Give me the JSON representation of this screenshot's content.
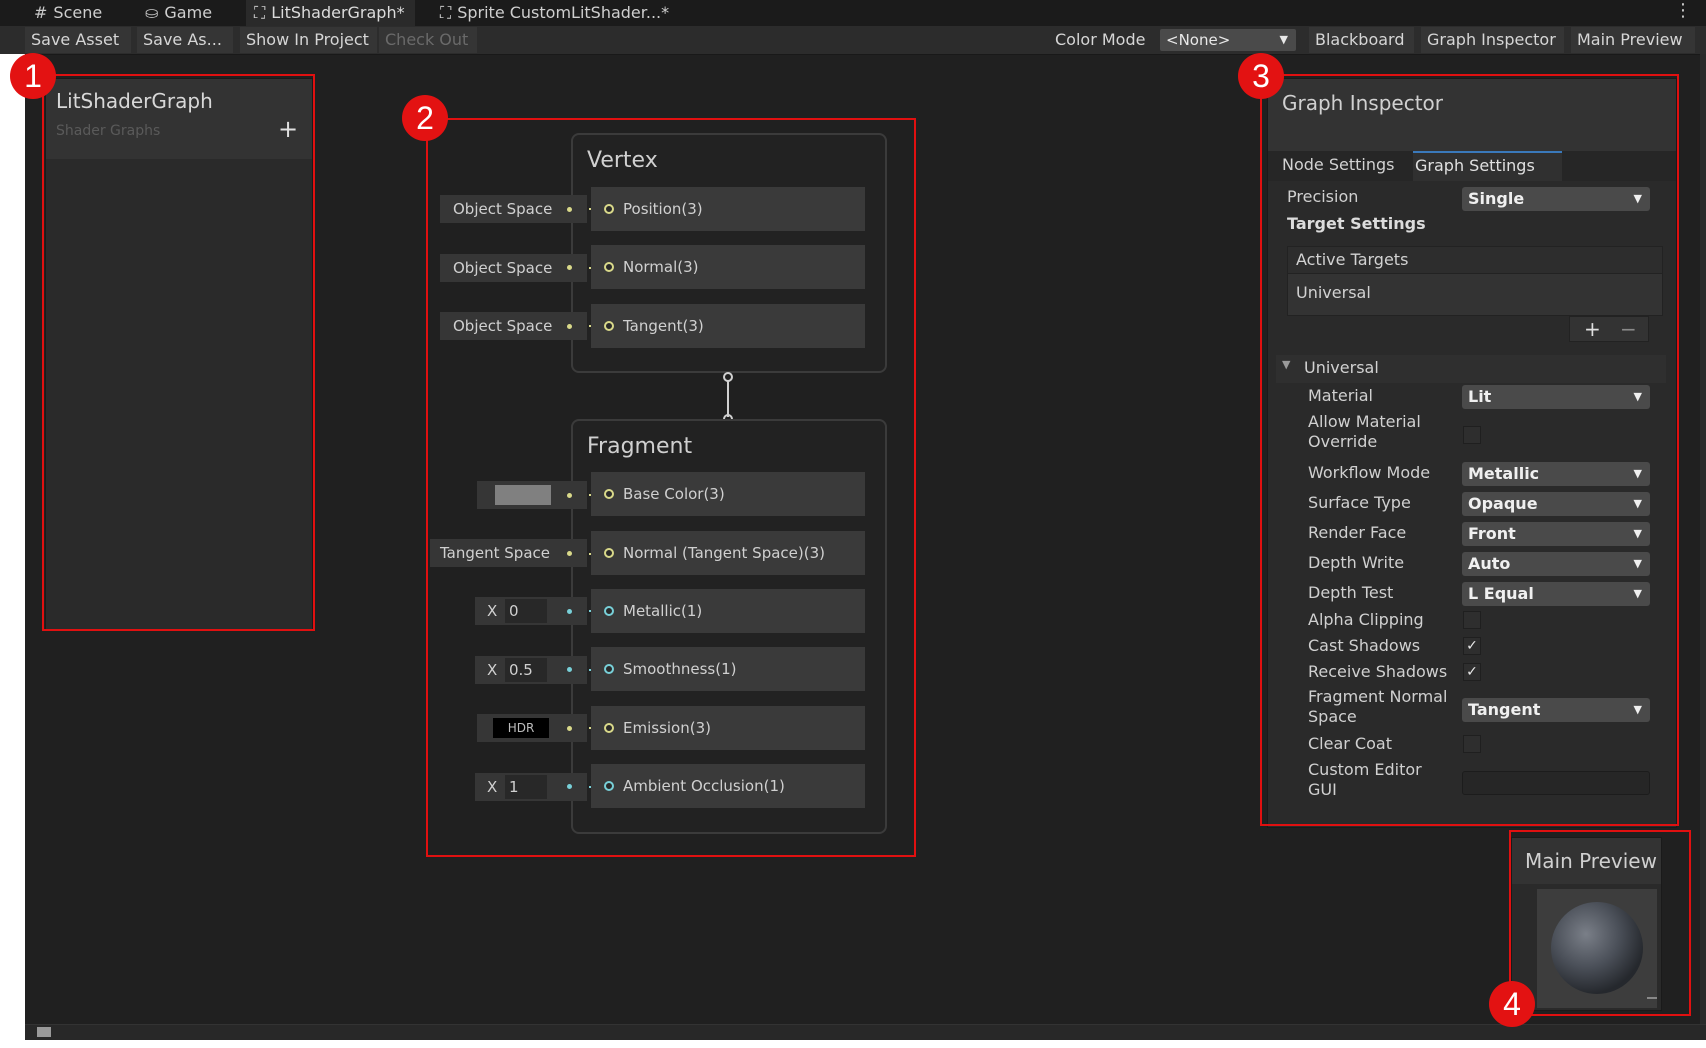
{
  "tabs": [
    {
      "icon": "#",
      "label": "Scene"
    },
    {
      "icon": "⛀",
      "label": "Game"
    },
    {
      "icon": "⛶",
      "label": "LitShaderGraph*"
    },
    {
      "icon": "⛶",
      "label": "Sprite CustomLitShader...*"
    }
  ],
  "toolbar": {
    "save_asset": "Save Asset",
    "save_as": "Save As...",
    "show_in_project": "Show In Project",
    "check_out": "Check Out",
    "color_mode_label": "Color Mode",
    "color_mode_value": "<None>",
    "blackboard": "Blackboard",
    "graph_inspector": "Graph Inspector",
    "main_preview": "Main Preview"
  },
  "badges": [
    "1",
    "2",
    "3",
    "4"
  ],
  "blackboard": {
    "title": "LitShaderGraph",
    "subtitle": "Shader Graphs",
    "add": "+"
  },
  "vertex": {
    "title": "Vertex",
    "slots": [
      {
        "input": "Object Space",
        "label": "Position(3)"
      },
      {
        "input": "Object Space",
        "label": "Normal(3)"
      },
      {
        "input": "Object Space",
        "label": "Tangent(3)"
      }
    ]
  },
  "fragment": {
    "title": "Fragment",
    "slots": [
      {
        "input": "",
        "label": "Base Color(3)"
      },
      {
        "input": "Tangent Space",
        "label": "Normal (Tangent Space)(3)"
      },
      {
        "axis": "X",
        "input": "0",
        "label": "Metallic(1)"
      },
      {
        "axis": "X",
        "input": "0.5",
        "label": "Smoothness(1)"
      },
      {
        "input": "HDR",
        "label": "Emission(3)"
      },
      {
        "axis": "X",
        "input": "1",
        "label": "Ambient Occlusion(1)"
      }
    ]
  },
  "inspector": {
    "title": "Graph Inspector",
    "tab_node": "Node Settings",
    "tab_graph": "Graph Settings",
    "precision_label": "Precision",
    "precision_value": "Single",
    "target_settings": "Target Settings",
    "active_targets": "Active Targets",
    "target_item": "Universal",
    "add_btn": "+",
    "remove_btn": "−",
    "section": "Universal",
    "material_label": "Material",
    "material_value": "Lit",
    "allow_override_label_1": "Allow Material",
    "allow_override_label_2": "Override",
    "workflow_label": "Workflow Mode",
    "workflow_value": "Metallic",
    "surface_label": "Surface Type",
    "surface_value": "Opaque",
    "render_face_label": "Render Face",
    "render_face_value": "Front",
    "depth_write_label": "Depth Write",
    "depth_write_value": "Auto",
    "depth_test_label": "Depth Test",
    "depth_test_value": "L Equal",
    "alpha_clip_label": "Alpha Clipping",
    "cast_shadows_label": "Cast Shadows",
    "receive_shadows_label": "Receive Shadows",
    "frag_normal_label_1": "Fragment Normal",
    "frag_normal_label_2": "Space",
    "frag_normal_value": "Tangent",
    "clear_coat_label": "Clear Coat",
    "custom_gui_label_1": "Custom Editor",
    "custom_gui_label_2": "GUI",
    "check": "✓"
  },
  "preview": {
    "title": "Main Preview"
  },
  "colors": {
    "highlight": "#e01010",
    "vector_port": "#d9d98a",
    "float_port": "#78d0d8"
  }
}
